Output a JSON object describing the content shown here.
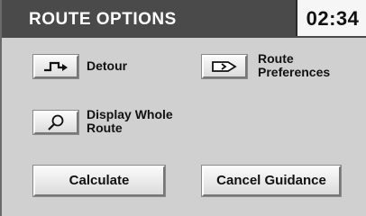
{
  "header": {
    "title": "ROUTE OPTIONS",
    "clock": "02:34"
  },
  "options": {
    "detour": {
      "label": "Detour",
      "icon": "detour-arrow-icon"
    },
    "route_preferences": {
      "label_line1": "Route",
      "label_line2": "Preferences",
      "icon": "arrow-right-icon"
    },
    "display_whole_route": {
      "label_line1": "Display Whole",
      "label_line2": "Route",
      "icon": "magnifier-icon"
    }
  },
  "actions": {
    "calculate_label": "Calculate",
    "cancel_guidance_label": "Cancel Guidance"
  },
  "colors": {
    "titlebar": "#4a4a4a",
    "background": "#d0d0d0",
    "button_face": "#f0f0f0"
  }
}
